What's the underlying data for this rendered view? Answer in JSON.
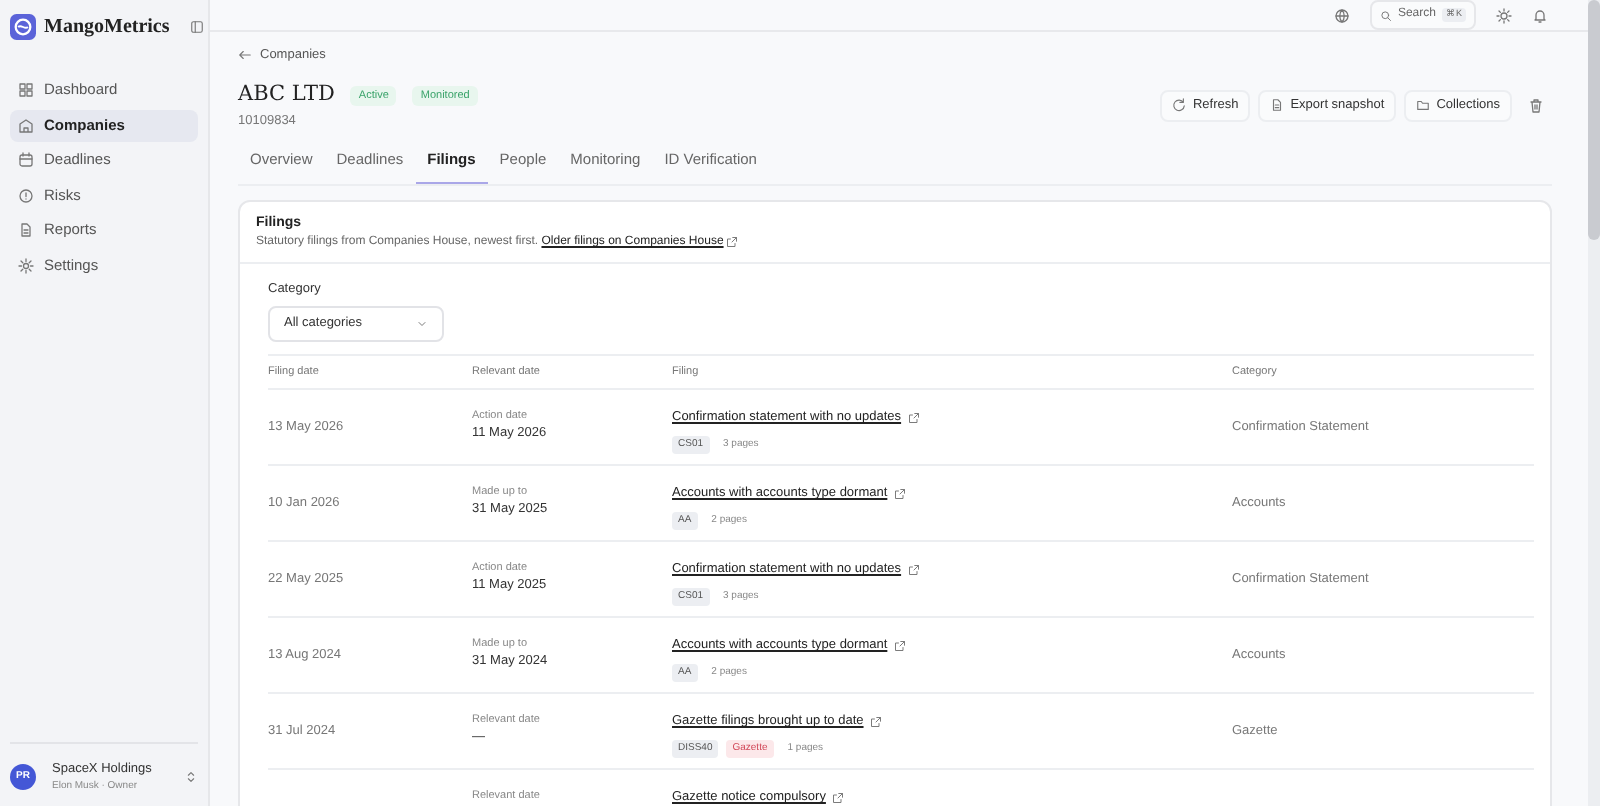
{
  "sidebar": {
    "brand": "MangoMetrics",
    "items": [
      {
        "label": "Dashboard",
        "kind": "grid",
        "selected": false
      },
      {
        "label": "Companies",
        "kind": "building",
        "selected": true
      },
      {
        "label": "Deadlines",
        "kind": "calendar",
        "selected": false
      },
      {
        "label": "Risks",
        "kind": "alert",
        "selected": false
      },
      {
        "label": "Reports",
        "kind": "doc",
        "selected": false
      },
      {
        "label": "Settings",
        "kind": "gear",
        "selected": false
      }
    ],
    "account": {
      "initials": "PR",
      "name": "SpaceX Holdings",
      "subtitle": "Elon Musk · Owner"
    }
  },
  "topbar": {
    "search": {
      "placeholder": "Search",
      "shortcut": "⌘K"
    }
  },
  "breadcrumb": "Companies",
  "company": {
    "name": "ABC LTD",
    "badges": [
      "Active",
      "Monitored"
    ],
    "number": "10109834"
  },
  "actions": [
    {
      "label": "Refresh",
      "kind": "refresh"
    },
    {
      "label": "Export snapshot",
      "kind": "doc"
    },
    {
      "label": "Collections",
      "kind": "folder"
    }
  ],
  "tabs": [
    {
      "label": "Overview",
      "selected": false
    },
    {
      "label": "Deadlines",
      "selected": false
    },
    {
      "label": "Filings",
      "selected": true
    },
    {
      "label": "People",
      "selected": false
    },
    {
      "label": "Monitoring",
      "selected": false
    },
    {
      "label": "ID Verification",
      "selected": false
    }
  ],
  "filings": {
    "title": "Filings",
    "subtitle": "Statutory filings from Companies House, newest first.",
    "link": "Older filings on Companies House",
    "filter": {
      "label": "Category",
      "value": "All categories"
    },
    "columns": [
      "Filing date",
      "Relevant date",
      "Filing",
      "Category"
    ],
    "rows": [
      {
        "filing_date": "13 May 2026",
        "relevant_label": "Action date",
        "relevant_date": "11 May 2026",
        "title": "Confirmation statement with no updates",
        "tags": [
          {
            "label": "CS01",
            "kind": "code"
          },
          {
            "label": "3 pages",
            "kind": "pages"
          }
        ],
        "category": "Confirmation Statement"
      },
      {
        "filing_date": "10 Jan 2026",
        "relevant_label": "Made up to",
        "relevant_date": "31 May 2025",
        "title": "Accounts with accounts type dormant",
        "tags": [
          {
            "label": "AA",
            "kind": "code"
          },
          {
            "label": "2 pages",
            "kind": "pages"
          }
        ],
        "category": "Accounts"
      },
      {
        "filing_date": "22 May 2025",
        "relevant_label": "Action date",
        "relevant_date": "11 May 2025",
        "title": "Confirmation statement with no updates",
        "tags": [
          {
            "label": "CS01",
            "kind": "code"
          },
          {
            "label": "3 pages",
            "kind": "pages"
          }
        ],
        "category": "Confirmation Statement"
      },
      {
        "filing_date": "13 Aug 2024",
        "relevant_label": "Made up to",
        "relevant_date": "31 May 2024",
        "title": "Accounts with accounts type dormant",
        "tags": [
          {
            "label": "AA",
            "kind": "code"
          },
          {
            "label": "2 pages",
            "kind": "pages"
          }
        ],
        "category": "Accounts"
      },
      {
        "filing_date": "31 Jul 2024",
        "relevant_label": "Relevant date",
        "relevant_date": "—",
        "title": "Gazette filings brought up to date",
        "tags": [
          {
            "label": "DISS40",
            "kind": "code"
          },
          {
            "label": "Gazette",
            "kind": "flag"
          },
          {
            "label": "1 pages",
            "kind": "pages"
          }
        ],
        "category": "Gazette"
      },
      {
        "relevant_label": "Relevant date",
        "title": "Gazette notice compulsory"
      }
    ]
  }
}
